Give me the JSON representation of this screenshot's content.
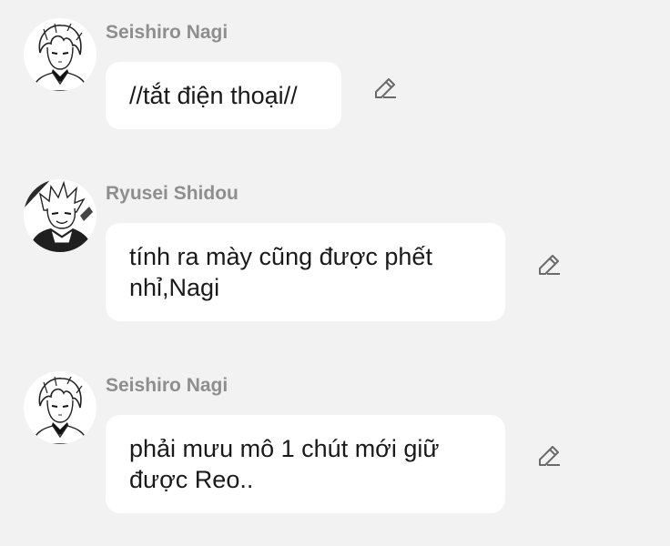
{
  "messages": [
    {
      "sender": "Seishiro Nagi",
      "text": "//tắt điện thoại//",
      "avatar_icon": "nagi-avatar",
      "action_icon": "pencil-edit-icon"
    },
    {
      "sender": "Ryusei Shidou",
      "text": "tính ra mày cũng được phết nhỉ,Nagi",
      "avatar_icon": "shidou-avatar",
      "action_icon": "pencil-edit-icon"
    },
    {
      "sender": "Seishiro Nagi",
      "text": "phải mưu mô 1 chút mới giữ được Reo..",
      "avatar_icon": "nagi-avatar",
      "action_icon": "pencil-edit-icon"
    }
  ],
  "colors": {
    "background": "#f2f2f2",
    "bubble": "#ffffff",
    "sender_name": "#8e8e8e",
    "message_text": "#1a1a1a",
    "icon": "#6a6a6a"
  }
}
